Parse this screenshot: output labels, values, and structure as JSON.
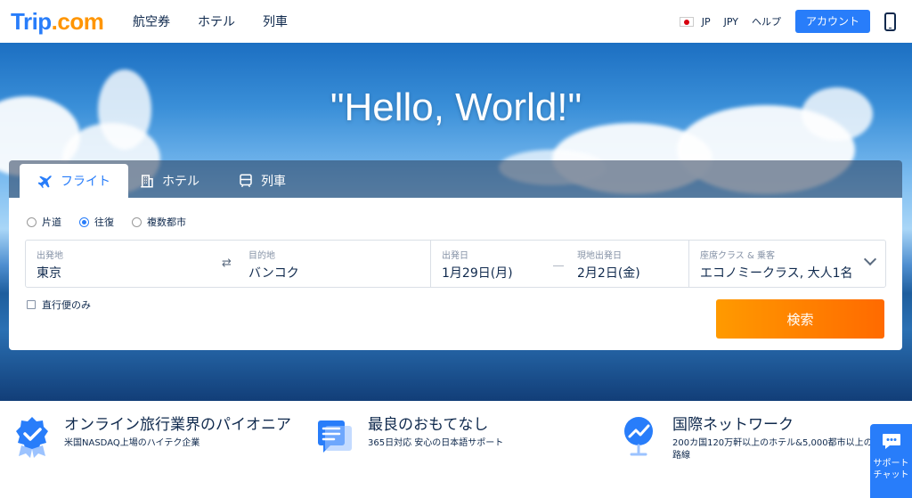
{
  "header": {
    "logo": "Trip",
    "logo_suffix": ".com",
    "nav": [
      "航空券",
      "ホテル",
      "列車"
    ],
    "language": "JP",
    "currency": "JPY",
    "help": "ヘルプ",
    "account_button": "アカウント"
  },
  "hero": {
    "headline": "\"Hello, World!\""
  },
  "search": {
    "tabs": [
      "フライト",
      "ホテル",
      "列車"
    ],
    "trip_types": [
      "片道",
      "往復",
      "複数都市"
    ],
    "selected_trip_type": "往復",
    "origin_label": "出発地",
    "origin_value": "東京",
    "destination_label": "目的地",
    "destination_value": "バンコク",
    "depart_label": "出発日",
    "depart_value": "1月29日(月)",
    "return_label": "現地出発日",
    "return_value": "2月2日(金)",
    "cabin_label": "座席クラス & 乗客",
    "cabin_value": "エコノミークラス, 大人1名",
    "direct_only": "直行便のみ",
    "search_button": "検索"
  },
  "features": [
    {
      "title": "オンライン旅行業界のパイオニア",
      "subtitle": "米国NASDAQ上場のハイテク企業",
      "icon": "badge-check-icon"
    },
    {
      "title": "最良のおもてなし",
      "subtitle": "365日対応 安心の日本語サポート",
      "icon": "chat-doc-icon"
    },
    {
      "title": "国際ネットワーク",
      "subtitle": "200カ国120万軒以上のホテル&5,000都市以上の路線",
      "icon": "globe-chart-icon"
    }
  ],
  "support_chat": "サポートチャット",
  "colors": {
    "brand_blue": "#287dfa",
    "accent_orange": "#ff7f00",
    "text_navy": "#0f294d"
  }
}
